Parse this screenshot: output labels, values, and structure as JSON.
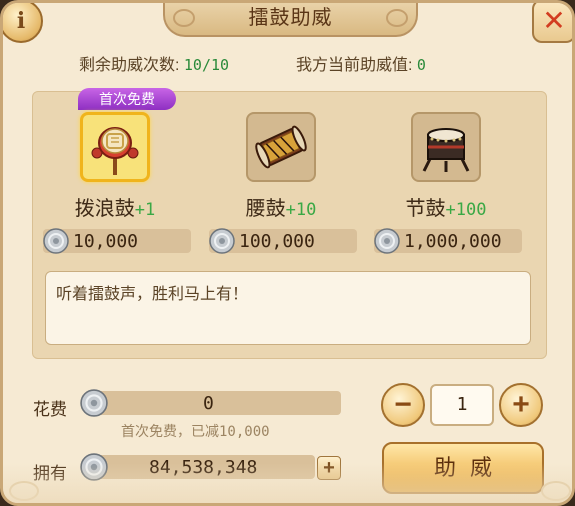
{
  "window": {
    "title": "擂鼓助威",
    "info_label": "i",
    "close_label": "✕"
  },
  "stats": {
    "remaining_label": "剩余助威次数:",
    "remaining_value": "10/10",
    "current_label": "我方当前助威值:",
    "current_value": "0"
  },
  "drums": [
    {
      "name": "拨浪鼓",
      "bonus": "+1",
      "price": "10,000",
      "badge": "首次免费",
      "selected": true,
      "icon": "rattle-drum-icon"
    },
    {
      "name": "腰鼓",
      "bonus": "+10",
      "price": "100,000",
      "selected": false,
      "icon": "waist-drum-icon"
    },
    {
      "name": "节鼓",
      "bonus": "+100",
      "price": "1,000,000",
      "selected": false,
      "icon": "festival-drum-icon"
    }
  ],
  "message": "听着擂鼓声，胜利马上有！",
  "cost": {
    "label": "花费",
    "value": "0",
    "note": "首次免费，已减10,000"
  },
  "owned": {
    "label": "拥有",
    "value": "84,538,348",
    "add_label": "+"
  },
  "quantity": {
    "minus_label": "−",
    "value": "1",
    "plus_label": "+"
  },
  "cheer_button_label": "助威",
  "colors": {
    "accent_green": "#3aa845",
    "badge_purple": "#a845d6",
    "close_red": "#d23c20",
    "panel_bg": "#f6ead3"
  }
}
